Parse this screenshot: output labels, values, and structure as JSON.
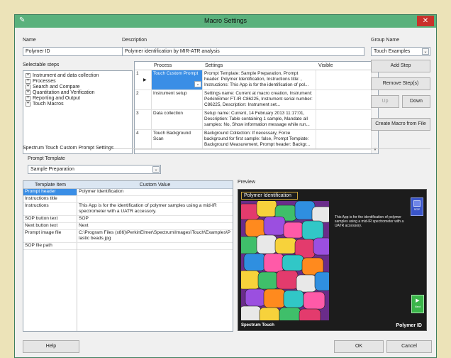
{
  "window": {
    "title": "Macro Settings"
  },
  "name": {
    "label": "Name",
    "value": "Polymer ID"
  },
  "description": {
    "label": "Description",
    "value": "Polymer identification by MIR-ATR analysis"
  },
  "group": {
    "label": "Group Name",
    "value": "Touch Examples"
  },
  "selectable": {
    "label": "Selectable steps",
    "items": [
      "Instrument and data collection",
      "Processes",
      "Search and Compare",
      "Quantitation and Verification",
      "Reporting and Output",
      "Touch Macros"
    ]
  },
  "steps": {
    "columns": [
      "Process",
      "Settings",
      "Visible"
    ],
    "rows": [
      {
        "num": "1",
        "process": "Touch Custom Prompt",
        "settings": "Prompt Template: Sample Preparation, Prompt header: Polymer Identification, Instructions title: , Instructions: This App is for the identification of pol..."
      },
      {
        "num": "2",
        "process": "Instrument setup",
        "settings": "Settings name: Current at macro creation, Instrument: PerkinElmer FT-IR C86225, Instrument serial number: C86225, Description: Instrument set..."
      },
      {
        "num": "3",
        "process": "Data collection",
        "settings": "Setup name: Current, 14 February 2013 11:17:01, Description: Table containing 1 sample, Mandate all samples: No, Show information message while run..."
      },
      {
        "num": "4",
        "process": "Touch Background Scan",
        "settings": "Background Collection: If necessary, Force background for first sample: false, Prompt Template: Background Measurement, Prompt header: Backgr..."
      }
    ]
  },
  "buttons": {
    "add": "Add Step",
    "remove": "Remove Step(s)",
    "up": "Up",
    "down": "Down",
    "create": "Create Macro from File",
    "help": "Help",
    "ok": "OK",
    "cancel": "Cancel"
  },
  "section": {
    "title": "Spectrum Touch Custom Prompt Settings",
    "template_label": "Prompt Template",
    "template_value": "Sample Preparation"
  },
  "props": {
    "columns": [
      "Template Item",
      "Custom Value"
    ],
    "rows": [
      {
        "key": "Prompt header",
        "value": "Polymer Identification"
      },
      {
        "key": "Instructions title",
        "value": ""
      },
      {
        "key": "Instructions",
        "value": "This App is for the identification of polymer samples using a mid-IR spectrometer with a UATR accessory."
      },
      {
        "key": "SOP button text",
        "value": "SOP"
      },
      {
        "key": "Next button text",
        "value": "Next"
      },
      {
        "key": "Prompt image file",
        "value": "C:\\Program Files (x86)\\PerkinElmer\\Spectrum\\Images\\Touch\\Examples\\Plastic beads.jpg"
      },
      {
        "key": "SOP file path",
        "value": ""
      }
    ]
  },
  "preview": {
    "label": "Preview",
    "header": "Polymer Identification",
    "text": "This App is for the identification of polymer samples using a mid-IR spectrometer with a UATR accessory.",
    "sop": "SOP",
    "next": "Next",
    "footer_left": "Spectrum Touch",
    "footer_right": "Polymer ID"
  },
  "colors": {
    "title_bar": "#5ab17c",
    "selection": "#3a8ee6",
    "close": "#c9312a",
    "preview_bg": "#1c1c1c"
  }
}
